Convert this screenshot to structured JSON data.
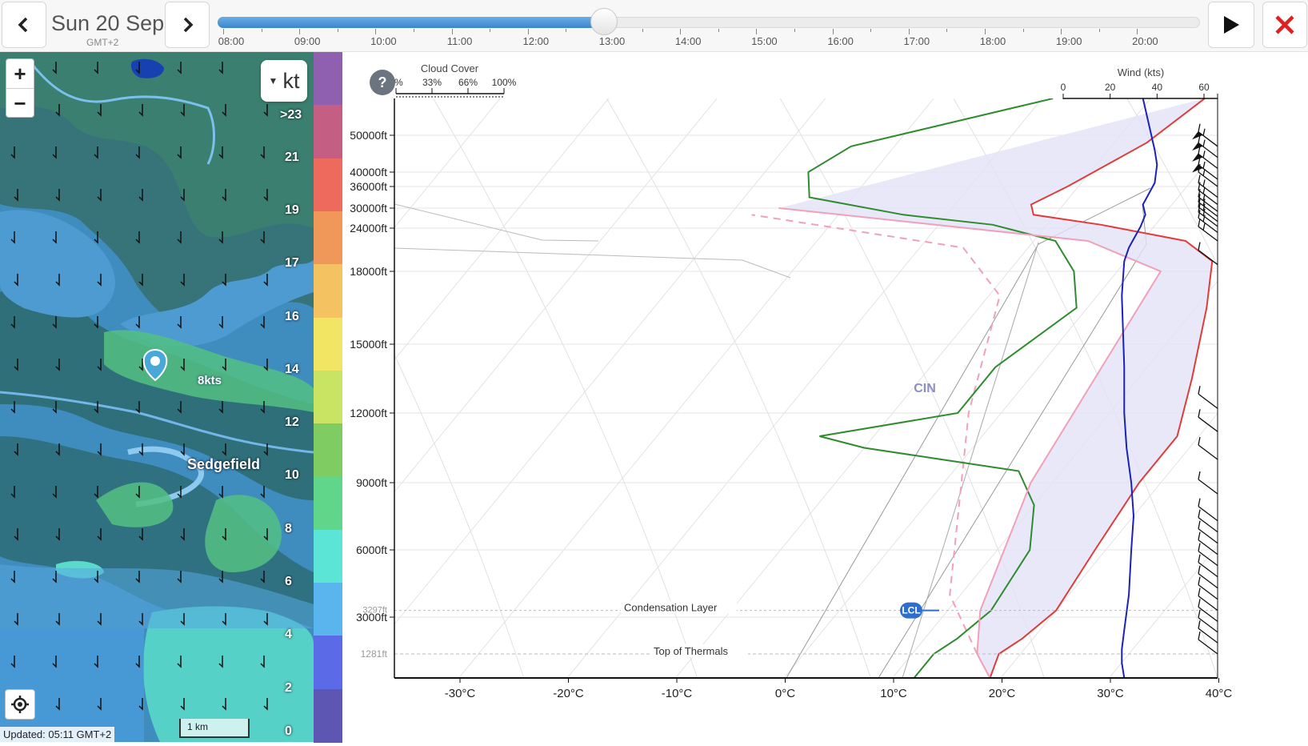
{
  "topbar": {
    "date": "Sun 20 Sep",
    "timezone": "GMT+2",
    "times": [
      "08:00",
      "09:00",
      "10:00",
      "11:00",
      "12:00",
      "13:00",
      "14:00",
      "15:00",
      "16:00",
      "17:00",
      "18:00",
      "19:00",
      "20:00"
    ],
    "selected_time": "13:00",
    "progress": 0.4
  },
  "map": {
    "unit": "kt",
    "place_name": "Sedgefield",
    "pin_speed": "8kts",
    "updated": "Updated: 05:11 GMT+2",
    "scale": "1 km",
    "zoom_in": "+",
    "zoom_out": "−",
    "legend": [
      {
        "label": ">23",
        "color": "#8f5fb0"
      },
      {
        "label": "21",
        "color": "#c45e82"
      },
      {
        "label": "19",
        "color": "#ee6a5c"
      },
      {
        "label": "17",
        "color": "#f0975a"
      },
      {
        "label": "16",
        "color": "#f4c260"
      },
      {
        "label": "14",
        "color": "#f2e564"
      },
      {
        "label": "12",
        "color": "#c9e463"
      },
      {
        "label": "10",
        "color": "#7fcc62"
      },
      {
        "label": "8",
        "color": "#5fd68a"
      },
      {
        "label": "6",
        "color": "#5be5d7"
      },
      {
        "label": "4",
        "color": "#5ab5ef"
      },
      {
        "label": "2",
        "color": "#5b6be8"
      },
      {
        "label": "0",
        "color": "#5d57b3"
      }
    ]
  },
  "skewt": {
    "help": "?",
    "cloud_cover_title": "Cloud Cover",
    "cloud_cover_ticks": [
      "0%",
      "33%",
      "66%",
      "100%"
    ],
    "wind_title": "Wind (kts)",
    "wind_ticks": [
      "0",
      "20",
      "40",
      "60"
    ],
    "alt_labels": [
      "50000ft",
      "40000ft",
      "36000ft",
      "30000ft",
      "24000ft",
      "18000ft",
      "15000ft",
      "12000ft",
      "9000ft",
      "6000ft",
      "3000ft"
    ],
    "temp_labels": [
      "-30°C",
      "-20°C",
      "-10°C",
      "0°C",
      "10°C",
      "20°C",
      "30°C",
      "40°C"
    ],
    "condensation_label": "Condensation Layer",
    "condensation_alt": "3297ft",
    "thermals_label": "Top of Thermals",
    "thermals_alt": "1281ft",
    "lcl_label": "LCL",
    "cin_label": "CIN"
  },
  "chart_data": {
    "type": "line",
    "title": "",
    "xlabel": "",
    "ylabel": "",
    "xlim": [
      -37,
      40
    ],
    "series": [
      {
        "name": "",
        "color": "#e03c3c",
        "points": [
          [
            19,
            0
          ],
          [
            18,
            1281
          ],
          [
            19,
            2000
          ],
          [
            20,
            3297
          ],
          [
            19,
            6000
          ],
          [
            18,
            9000
          ],
          [
            18,
            11000
          ],
          [
            15,
            13500
          ],
          [
            11,
            16500
          ],
          [
            8,
            19500
          ],
          [
            4,
            22500
          ],
          [
            -5,
            25000
          ],
          [
            -12,
            28000
          ],
          [
            -13,
            31000
          ],
          [
            -11,
            36000
          ],
          [
            -9,
            42000
          ],
          [
            -7,
            48000
          ],
          [
            -5,
            53000
          ]
        ]
      },
      {
        "name": "",
        "color": "#2e8b2e",
        "points": [
          [
            12,
            0
          ],
          [
            12,
            1281
          ],
          [
            13,
            2000
          ],
          [
            14,
            3297
          ],
          [
            13,
            6000
          ],
          [
            10,
            8000
          ],
          [
            6,
            9500
          ],
          [
            -2,
            10000
          ],
          [
            -10,
            10500
          ],
          [
            -15,
            11000
          ],
          [
            -4,
            12000
          ],
          [
            -4,
            14000
          ],
          [
            -1,
            16500
          ],
          [
            -4,
            18000
          ],
          [
            -8,
            22500
          ],
          [
            -15,
            25000
          ],
          [
            -24,
            28000
          ],
          [
            -34,
            33000
          ],
          [
            -36,
            40000
          ],
          [
            -34,
            47000
          ],
          [
            -19,
            53000
          ]
        ]
      },
      {
        "name": "",
        "color": "#f0a0b8",
        "points": [
          [
            19,
            0
          ],
          [
            16,
            1281
          ],
          [
            13,
            3297
          ],
          [
            8,
            9000
          ],
          [
            4,
            18000
          ],
          [
            -5,
            22500
          ],
          [
            -36,
            30000
          ]
        ]
      },
      {
        "name": "",
        "color": "#1a22b8",
        "points": [
          [
            26,
            0
          ],
          [
            25,
            800
          ],
          [
            25,
            1500
          ],
          [
            26,
            2400
          ],
          [
            28,
            4000
          ],
          [
            29,
            6000
          ],
          [
            30,
            7500
          ],
          [
            29,
            9000
          ],
          [
            27,
            10500
          ],
          [
            26,
            12000
          ],
          [
            26,
            14000
          ],
          [
            25,
            17000
          ],
          [
            26,
            19500
          ],
          [
            28,
            21500
          ],
          [
            33,
            24500
          ],
          [
            35,
            28000
          ],
          [
            34,
            31000
          ],
          [
            39,
            37000
          ],
          [
            40,
            42000
          ],
          [
            39,
            46000
          ],
          [
            34,
            53000
          ]
        ]
      }
    ]
  }
}
